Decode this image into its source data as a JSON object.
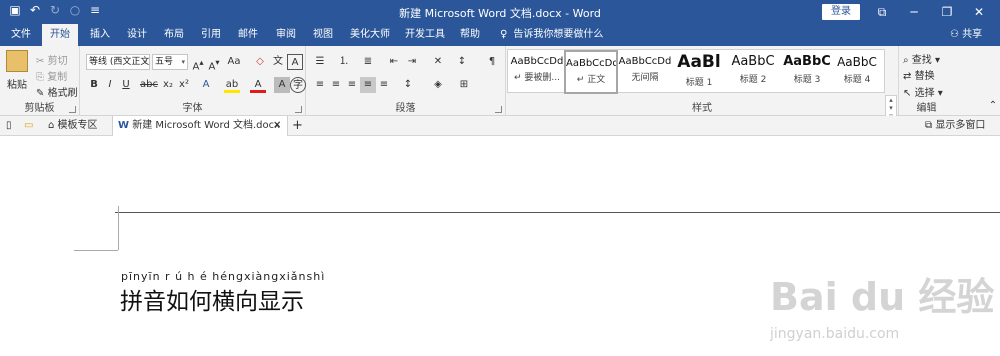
{
  "title_bar": {
    "title": "新建 Microsoft Word 文档.docx - Word",
    "login_label": "登录"
  },
  "quick_access": {
    "icons": [
      "save-icon",
      "undo-icon",
      "redo-icon",
      "circle-icon",
      "customize-icon"
    ]
  },
  "tabs": [
    {
      "label": "文件"
    },
    {
      "label": "开始"
    },
    {
      "label": "插入"
    },
    {
      "label": "设计"
    },
    {
      "label": "布局"
    },
    {
      "label": "引用"
    },
    {
      "label": "邮件"
    },
    {
      "label": "审阅"
    },
    {
      "label": "视图"
    },
    {
      "label": "美化大师"
    },
    {
      "label": "开发工具"
    },
    {
      "label": "帮助"
    }
  ],
  "tell_me": "告诉我你想要做什么",
  "share_label": "共享",
  "clipboard": {
    "paste": "粘贴",
    "cut": "剪切",
    "copy": "复制",
    "format_painter": "格式刷",
    "label": "剪贴板"
  },
  "font": {
    "font_name": "等线 (西文正文)",
    "font_size": "五号",
    "label": "字体"
  },
  "paragraph": {
    "label": "段落"
  },
  "styles": {
    "label": "样式",
    "items": [
      {
        "preview": "AaBbCcDd",
        "name": "↵ 要被删..."
      },
      {
        "preview": "AaBbCcDd",
        "name": "↵ 正文"
      },
      {
        "preview": "AaBbCcDd",
        "name": "无间隔"
      },
      {
        "preview": "AaBl",
        "name": "标题 1"
      },
      {
        "preview": "AaBbC",
        "name": "标题 2"
      },
      {
        "preview": "AaBbC",
        "name": "标题 3"
      },
      {
        "preview": "AaBbC",
        "name": "标题 4"
      }
    ]
  },
  "editing": {
    "find": "查找",
    "replace": "替换",
    "select": "选择",
    "label": "编辑"
  },
  "doc_tabs": {
    "template_zone": "模板专区",
    "active_doc": "新建 Microsoft Word 文档.docx",
    "multi_window": "显示多窗口"
  },
  "document": {
    "pinyin": "pīnyīn r ú h é héngxiàngxiǎnshì",
    "text": "拼音如何横向显示"
  },
  "watermark": {
    "main": "Bai du 经验",
    "sub": "jingyan.baidu.com"
  }
}
